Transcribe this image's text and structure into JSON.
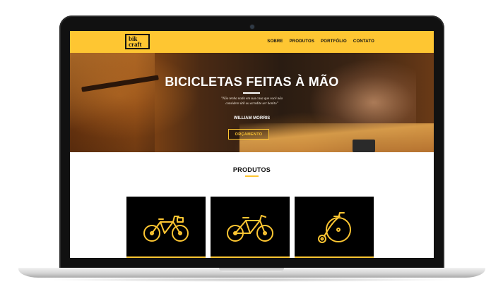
{
  "site": {
    "logo": {
      "line1": "bik",
      "line2": "craft"
    },
    "nav": [
      "SOBRE",
      "PRODUTOS",
      "PORTFÓLIO",
      "CONTATO"
    ]
  },
  "hero": {
    "title": "BICICLETAS FEITAS À MÃO",
    "quote_line1": "\"Não tenha nada em sua casa que você não",
    "quote_line2": "considere útil ou acredite ser bonito\"",
    "author": "WILLIAM MORRIS",
    "button": "ORÇAMENTO"
  },
  "products": {
    "title": "PRODUTOS",
    "items": [
      {
        "icon": "city-bike-icon"
      },
      {
        "icon": "road-bike-icon"
      },
      {
        "icon": "penny-farthing-icon"
      }
    ]
  },
  "colors": {
    "accent": "#fec632",
    "dark": "#000000",
    "text": "#111111"
  }
}
